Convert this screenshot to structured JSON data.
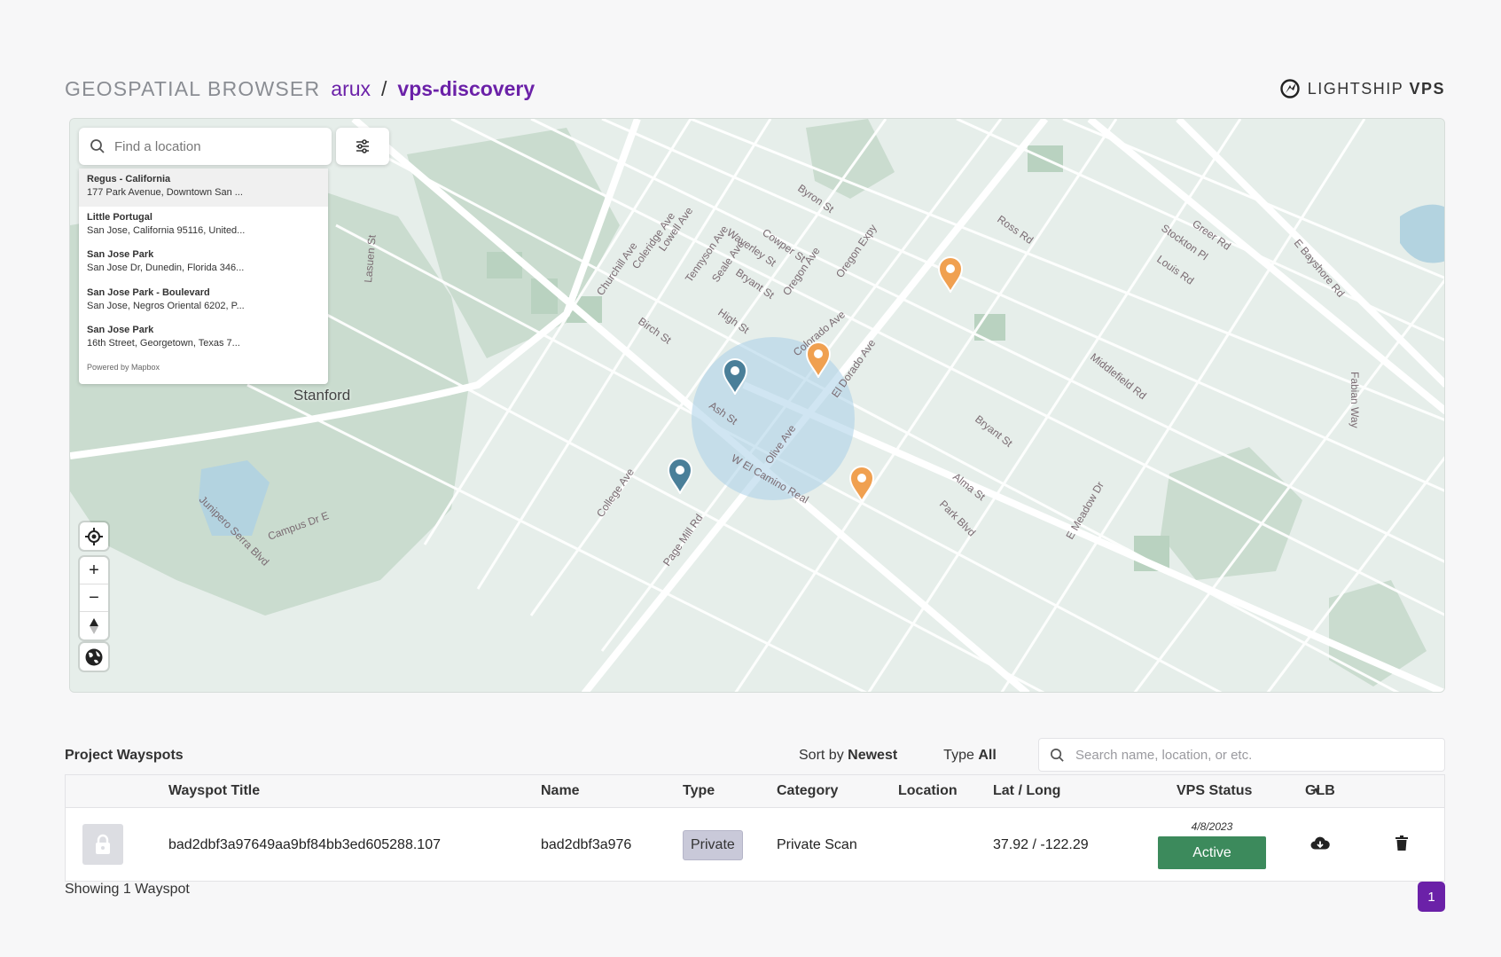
{
  "header": {
    "app_name": "GEOSPATIAL BROWSER",
    "org": "arux",
    "separator": "/",
    "project": "vps-discovery",
    "brand_light": "LIGHTSHIP",
    "brand_bold": "VPS"
  },
  "map": {
    "search_placeholder": "Find a location",
    "results": [
      {
        "title": "Regus - California",
        "subtitle": "177 Park Avenue, Downtown San ..."
      },
      {
        "title": "Little Portugal",
        "subtitle": "San Jose, California 95116, United..."
      },
      {
        "title": "San Jose Park",
        "subtitle": "San Jose Dr, Dunedin, Florida 346..."
      },
      {
        "title": "San Jose Park - Boulevard",
        "subtitle": "San Jose, Negros Oriental 6202, P..."
      },
      {
        "title": "San Jose Park",
        "subtitle": "16th Street, Georgetown, Texas 7..."
      }
    ],
    "powered_by": "Powered by Mapbox",
    "place_label": "Stanford",
    "street_labels": [
      "Churchill Ave",
      "Coleridge Ave",
      "Lowell Ave",
      "Tennyson Ave",
      "Seale Ave",
      "Waverley St",
      "Cowper St",
      "Byron St",
      "Oregon Expy",
      "Bryant St",
      "Oregon Ave",
      "Birch St",
      "High St",
      "Colorado Ave",
      "Ash St",
      "El Dorado Ave",
      "Olive Ave",
      "W El Camino Real",
      "College Ave",
      "Page Mill Rd",
      "Campus Dr E",
      "Junipero Serra Blvd",
      "Lasuen St",
      "Ross Rd",
      "Greer Rd",
      "Stockton Pl",
      "Louis Rd",
      "Middlefield Rd",
      "E Bayshore Rd",
      "Fabian Way",
      "Alma St",
      "Park Blvd",
      "E Meadow Dr",
      "Bryant St"
    ],
    "colors": {
      "pin_orange": "#f0a050",
      "pin_teal": "#4a7f99",
      "land": "#e6eeea",
      "park": "#c9dccf",
      "road": "#ffffff",
      "water": "#b3d3e0"
    }
  },
  "wayspots": {
    "title": "Project Wayspots",
    "sort_label": "Sort by",
    "sort_value": "Newest",
    "type_label": "Type",
    "type_value": "All",
    "search_placeholder": "Search name, location, or etc.",
    "columns": [
      "Wayspot Title",
      "Name",
      "Type",
      "Category",
      "Location",
      "Lat / Long",
      "VPS Status",
      "GLB"
    ],
    "rows": [
      {
        "title": "bad2dbf3a97649aa9bf84bb3ed605288.107",
        "name": "bad2dbf3a976",
        "type": "Private",
        "category": "Private Scan",
        "location": "",
        "latlong": "37.92 / -122.29",
        "vps_date": "4/8/2023",
        "vps_status": "Active"
      }
    ],
    "showing": "Showing 1 Wayspot",
    "page": "1"
  }
}
